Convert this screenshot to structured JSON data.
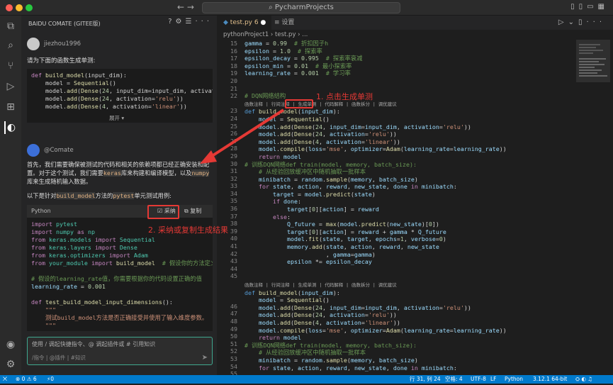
{
  "window": {
    "search": "PycharmProjects",
    "nav": "←  →"
  },
  "chat": {
    "title": "BAIDU COMATE (GITEE版)",
    "user": "jiezhou1996",
    "user_prompt": "请为下面的函数生成单测:",
    "expand": "展开 ▾",
    "bot": "@Comate",
    "para1_a": "首先，我们需要确保被测试的代码和相关的依赖项都已经正确安装和配置。对于这个测试，我们需要",
    "para1_keras": "keras",
    "para1_b": "库来构建和编译模型，以及",
    "para1_numpy": "numpy",
    "para1_c": "库来生成随机输入数据。",
    "para2_a": "以下是针对",
    "para2_fn": "build_model",
    "para2_b": "方法的",
    "para2_pt": "pytest",
    "para2_c": "单元测试用例:",
    "code_lang": "Python",
    "adopt": "采纳",
    "copy": "复制",
    "input_placeholder": "使用 / 调起快捷指令、@ 调起插件或 # 引用知识",
    "input_hints": "/指令 | @插件 | #知识"
  },
  "editor": {
    "tab1": "test.py",
    "tab1_badge": "6",
    "tab2": "设置",
    "breadcrumb": "pythonProject1 › test.py › ...",
    "codelens": "函数注释 | 行间注释 | 生成单测 | 代码解释 | 函数拆分 | 调优建议"
  },
  "annotations": {
    "a1": "1. 点击生成单测",
    "a2": "2. 采纳或复制生成结果"
  },
  "status": {
    "errors": "⊗ 0 ⚠ 6",
    "ports": "⚡0",
    "pos": "行 31, 列 24",
    "spaces": "空格: 4",
    "enc": "UTF-8",
    "eol": "LF",
    "lang": "Python",
    "interp": "3.12.1 64-bit"
  }
}
